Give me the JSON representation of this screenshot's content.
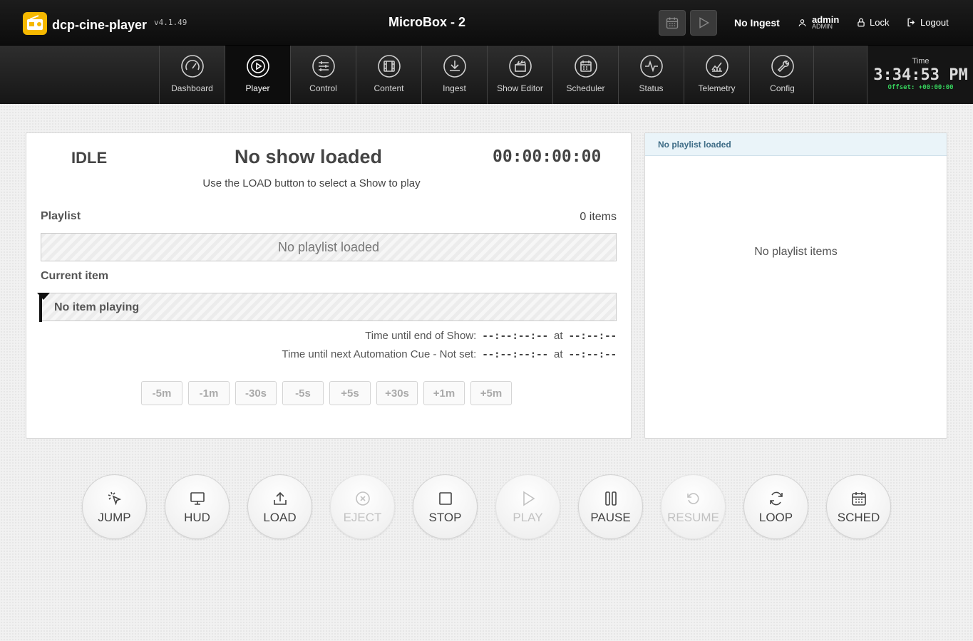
{
  "app": {
    "name": "dcp-cine-player",
    "version": "v4.1.49",
    "device_name": "MicroBox - 2",
    "logo_color": "#f5b800"
  },
  "topbar": {
    "ingest_status": "No Ingest",
    "user": {
      "name": "admin",
      "role": "ADMIN"
    },
    "lock_label": "Lock",
    "logout_label": "Logout"
  },
  "nav": {
    "items": [
      {
        "label": "Dashboard",
        "icon": "dashboard-gauge-icon"
      },
      {
        "label": "Player",
        "icon": "play-circle-icon",
        "active": true
      },
      {
        "label": "Control",
        "icon": "sliders-icon"
      },
      {
        "label": "Content",
        "icon": "film-icon"
      },
      {
        "label": "Ingest",
        "icon": "download-icon"
      },
      {
        "label": "Show Editor",
        "icon": "clapperboard-icon"
      },
      {
        "label": "Scheduler",
        "icon": "calendar-icon"
      },
      {
        "label": "Status",
        "icon": "activity-icon"
      },
      {
        "label": "Telemetry",
        "icon": "chart-icon"
      },
      {
        "label": "Config",
        "icon": "wrench-icon"
      }
    ]
  },
  "clock": {
    "label": "Time",
    "time": "3:34:53 PM",
    "offset": "Offset: +00:00:00",
    "offset_color": "#36d05c"
  },
  "player": {
    "state": "IDLE",
    "show_title": "No show loaded",
    "timecode": "00:00:00:00",
    "hint": "Use the LOAD button to select a Show to play",
    "playlist_label": "Playlist",
    "playlist_count": "0 items",
    "playlist_status": "No playlist loaded",
    "current_item_label": "Current item",
    "current_item": "No item playing",
    "end_of_show_label": "Time until end of Show:",
    "end_of_show_value": "--:--:--:--",
    "end_of_show_at": "--:--:--",
    "next_cue_label": "Time until next Automation Cue - Not set:",
    "next_cue_value": "--:--:--:--",
    "next_cue_at": "--:--:--",
    "at_label": "at",
    "adjust_buttons": [
      "-5m",
      "-1m",
      "-30s",
      "-5s",
      "+5s",
      "+30s",
      "+1m",
      "+5m"
    ]
  },
  "side_panel": {
    "header": "No playlist loaded",
    "empty_text": "No playlist items",
    "header_color": "#3e6c86"
  },
  "transport": {
    "buttons": [
      {
        "label": "JUMP",
        "icon": "cursor-click-icon",
        "enabled": true
      },
      {
        "label": "HUD",
        "icon": "monitor-icon",
        "enabled": true
      },
      {
        "label": "LOAD",
        "icon": "upload-icon",
        "enabled": true
      },
      {
        "label": "EJECT",
        "icon": "x-circle-icon",
        "enabled": false
      },
      {
        "label": "STOP",
        "icon": "stop-square-icon",
        "enabled": true
      },
      {
        "label": "PLAY",
        "icon": "play-icon",
        "enabled": false
      },
      {
        "label": "PAUSE",
        "icon": "pause-icon",
        "enabled": true
      },
      {
        "label": "RESUME",
        "icon": "rotate-ccw-icon",
        "enabled": false
      },
      {
        "label": "LOOP",
        "icon": "refresh-icon",
        "enabled": true
      },
      {
        "label": "SCHED",
        "icon": "calendar-icon",
        "enabled": true
      }
    ]
  }
}
